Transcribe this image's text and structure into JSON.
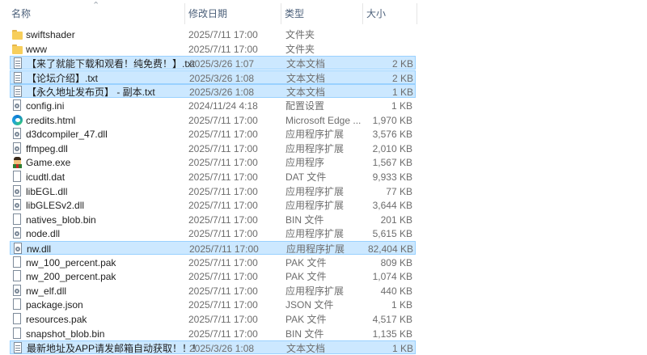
{
  "headers": {
    "name": "名称",
    "date": "修改日期",
    "type": "类型",
    "size": "大小"
  },
  "rows": [
    {
      "name": "swiftshader",
      "date": "2025/7/11 17:00",
      "type": "文件夹",
      "size": "",
      "icon": "folder",
      "selected": false
    },
    {
      "name": "www",
      "date": "2025/7/11 17:00",
      "type": "文件夹",
      "size": "",
      "icon": "folder",
      "selected": false
    },
    {
      "name": "【来了就能下载和观看！纯免费！】.txt",
      "date": "2025/3/26 1:07",
      "type": "文本文档",
      "size": "2 KB",
      "icon": "text-file",
      "selected": true
    },
    {
      "name": "【论坛介绍】.txt",
      "date": "2025/3/26 1:08",
      "type": "文本文档",
      "size": "2 KB",
      "icon": "text-file",
      "selected": true
    },
    {
      "name": "【永久地址发布页】 - 副本.txt",
      "date": "2025/3/26 1:08",
      "type": "文本文档",
      "size": "1 KB",
      "icon": "text-file",
      "selected": true
    },
    {
      "name": "config.ini",
      "date": "2024/11/24 4:18",
      "type": "配置设置",
      "size": "1 KB",
      "icon": "settings-file",
      "selected": false
    },
    {
      "name": "credits.html",
      "date": "2025/7/11 17:00",
      "type": "Microsoft Edge ...",
      "size": "1,970 KB",
      "icon": "edge",
      "selected": false
    },
    {
      "name": "d3dcompiler_47.dll",
      "date": "2025/7/11 17:00",
      "type": "应用程序扩展",
      "size": "3,576 KB",
      "icon": "settings-file",
      "selected": false
    },
    {
      "name": "ffmpeg.dll",
      "date": "2025/7/11 17:00",
      "type": "应用程序扩展",
      "size": "2,010 KB",
      "icon": "settings-file",
      "selected": false
    },
    {
      "name": "Game.exe",
      "date": "2025/7/11 17:00",
      "type": "应用程序",
      "size": "1,567 KB",
      "icon": "game",
      "selected": false
    },
    {
      "name": "icudtl.dat",
      "date": "2025/7/11 17:00",
      "type": "DAT 文件",
      "size": "9,933 KB",
      "icon": "blank-file",
      "selected": false
    },
    {
      "name": "libEGL.dll",
      "date": "2025/7/11 17:00",
      "type": "应用程序扩展",
      "size": "77 KB",
      "icon": "settings-file",
      "selected": false
    },
    {
      "name": "libGLESv2.dll",
      "date": "2025/7/11 17:00",
      "type": "应用程序扩展",
      "size": "3,644 KB",
      "icon": "settings-file",
      "selected": false
    },
    {
      "name": "natives_blob.bin",
      "date": "2025/7/11 17:00",
      "type": "BIN 文件",
      "size": "201 KB",
      "icon": "blank-file",
      "selected": false
    },
    {
      "name": "node.dll",
      "date": "2025/7/11 17:00",
      "type": "应用程序扩展",
      "size": "5,615 KB",
      "icon": "settings-file",
      "selected": false
    },
    {
      "name": "nw.dll",
      "date": "2025/7/11 17:00",
      "type": "应用程序扩展",
      "size": "82,404 KB",
      "icon": "settings-file",
      "selected": true
    },
    {
      "name": "nw_100_percent.pak",
      "date": "2025/7/11 17:00",
      "type": "PAK 文件",
      "size": "809 KB",
      "icon": "blank-file",
      "selected": false
    },
    {
      "name": "nw_200_percent.pak",
      "date": "2025/7/11 17:00",
      "type": "PAK 文件",
      "size": "1,074 KB",
      "icon": "blank-file",
      "selected": false
    },
    {
      "name": "nw_elf.dll",
      "date": "2025/7/11 17:00",
      "type": "应用程序扩展",
      "size": "440 KB",
      "icon": "settings-file",
      "selected": false
    },
    {
      "name": "package.json",
      "date": "2025/7/11 17:00",
      "type": "JSON 文件",
      "size": "1 KB",
      "icon": "blank-file",
      "selected": false
    },
    {
      "name": "resources.pak",
      "date": "2025/7/11 17:00",
      "type": "PAK 文件",
      "size": "4,517 KB",
      "icon": "blank-file",
      "selected": false
    },
    {
      "name": "snapshot_blob.bin",
      "date": "2025/7/11 17:00",
      "type": "BIN 文件",
      "size": "1,135 KB",
      "icon": "blank-file",
      "selected": false
    },
    {
      "name": "最新地址及APP请发邮箱自动获取！！！....",
      "date": "2025/3/26 1:08",
      "type": "文本文档",
      "size": "1 KB",
      "icon": "text-file",
      "selected": true
    }
  ]
}
